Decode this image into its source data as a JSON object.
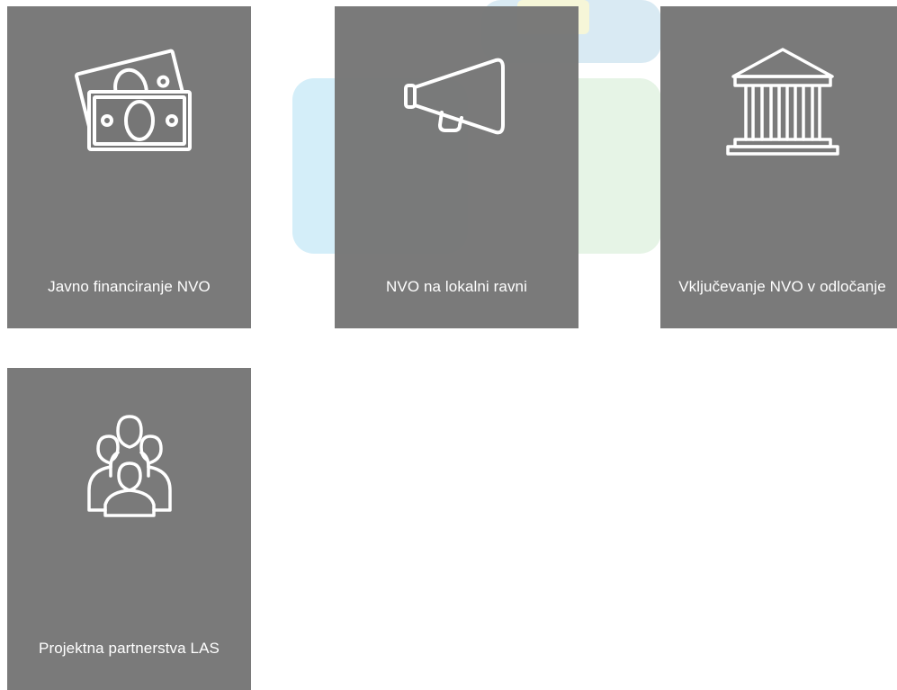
{
  "tiles": [
    {
      "label": "Javno financiranje NVO",
      "icon": "money-icon"
    },
    {
      "label": "NVO na lokalni ravni",
      "icon": "megaphone-icon"
    },
    {
      "label": "Vključevanje NVO v odločanje",
      "icon": "government-building-icon"
    },
    {
      "label": "Projektna partnerstva LAS",
      "icon": "people-group-icon"
    }
  ],
  "colors": {
    "tile_bg": "#767676",
    "tile_text": "#ffffff",
    "decor_blue": "#d4eef9",
    "decor_green": "#e6f4e6",
    "decor_yellow": "#f7f7d9"
  }
}
